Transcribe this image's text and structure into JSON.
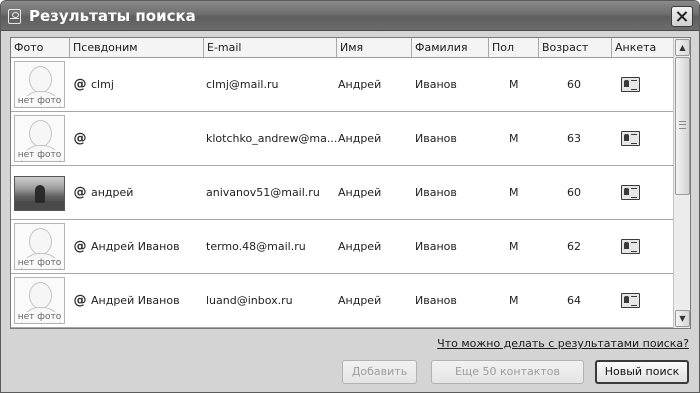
{
  "window": {
    "title": "Результаты поиска"
  },
  "columns": [
    "Фото",
    "Псевдоним",
    "E-mail",
    "Имя",
    "Фамилия",
    "Пол",
    "Возраст",
    "Анкета"
  ],
  "rows": [
    {
      "photo": "нет фото",
      "nickname": "clmj",
      "email": "clmj@mail.ru",
      "first_name": "Андрей",
      "last_name": "Иванов",
      "gender": "М",
      "age": "60"
    },
    {
      "photo": "нет фото",
      "nickname": "",
      "email": "klotchko_andrew@ma...",
      "first_name": "Андрей",
      "last_name": "Иванов",
      "gender": "М",
      "age": "63"
    },
    {
      "nickname": "андрей",
      "email": "anivanov51@mail.ru",
      "first_name": "Андрей",
      "last_name": "Иванов",
      "gender": "М",
      "age": "60"
    },
    {
      "photo": "нет фото",
      "nickname": "Андрей Иванов",
      "email": "termo.48@mail.ru",
      "first_name": "Андрей",
      "last_name": "Иванов",
      "gender": "М",
      "age": "62"
    },
    {
      "photo": "нет фото",
      "nickname": "Андрей Иванов",
      "email": "luand@inbox.ru",
      "first_name": "Андрей",
      "last_name": "Иванов",
      "gender": "М",
      "age": "64"
    }
  ],
  "footer": {
    "help_link": "Что можно делать с результатами поиска?",
    "add_button": "Добавить",
    "more_button": "Еще 50 контактов",
    "new_search_button": "Новый поиск"
  }
}
